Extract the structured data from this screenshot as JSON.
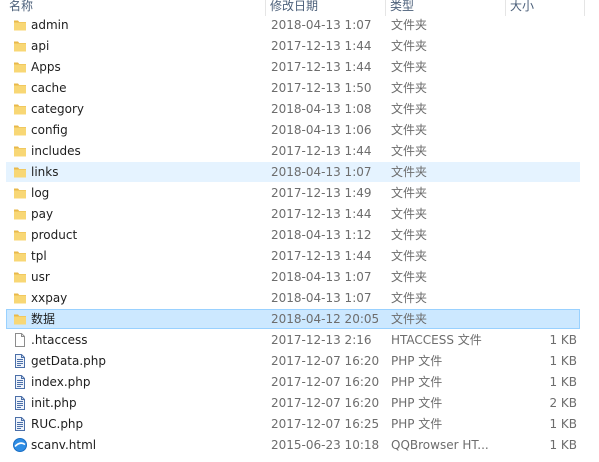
{
  "columns": {
    "name": "名称",
    "date": "修改日期",
    "type": "类型",
    "size": "大小"
  },
  "files": [
    {
      "name": "admin",
      "date": "2018-04-13 1:07",
      "type": "文件夹",
      "size": "",
      "icon": "folder-icon",
      "state": "normal"
    },
    {
      "name": "api",
      "date": "2017-12-13 1:44",
      "type": "文件夹",
      "size": "",
      "icon": "folder-icon",
      "state": "normal"
    },
    {
      "name": "Apps",
      "date": "2017-12-13 1:44",
      "type": "文件夹",
      "size": "",
      "icon": "folder-icon",
      "state": "normal"
    },
    {
      "name": "cache",
      "date": "2017-12-13 1:50",
      "type": "文件夹",
      "size": "",
      "icon": "folder-icon",
      "state": "normal"
    },
    {
      "name": "category",
      "date": "2018-04-13 1:08",
      "type": "文件夹",
      "size": "",
      "icon": "folder-icon",
      "state": "normal"
    },
    {
      "name": "config",
      "date": "2018-04-13 1:06",
      "type": "文件夹",
      "size": "",
      "icon": "folder-icon",
      "state": "normal"
    },
    {
      "name": "includes",
      "date": "2017-12-13 1:44",
      "type": "文件夹",
      "size": "",
      "icon": "folder-icon",
      "state": "normal"
    },
    {
      "name": "links",
      "date": "2018-04-13 1:07",
      "type": "文件夹",
      "size": "",
      "icon": "folder-icon",
      "state": "hover"
    },
    {
      "name": "log",
      "date": "2017-12-13 1:49",
      "type": "文件夹",
      "size": "",
      "icon": "folder-icon",
      "state": "normal"
    },
    {
      "name": "pay",
      "date": "2017-12-13 1:44",
      "type": "文件夹",
      "size": "",
      "icon": "folder-icon",
      "state": "normal"
    },
    {
      "name": "product",
      "date": "2018-04-13 1:12",
      "type": "文件夹",
      "size": "",
      "icon": "folder-icon",
      "state": "normal"
    },
    {
      "name": "tpl",
      "date": "2017-12-13 1:44",
      "type": "文件夹",
      "size": "",
      "icon": "folder-icon",
      "state": "normal"
    },
    {
      "name": "usr",
      "date": "2018-04-13 1:07",
      "type": "文件夹",
      "size": "",
      "icon": "folder-icon",
      "state": "normal"
    },
    {
      "name": "xxpay",
      "date": "2018-04-13 1:07",
      "type": "文件夹",
      "size": "",
      "icon": "folder-icon",
      "state": "normal"
    },
    {
      "name": "数据",
      "date": "2018-04-12 20:05",
      "type": "文件夹",
      "size": "",
      "icon": "folder-icon",
      "state": "selected"
    },
    {
      "name": ".htaccess",
      "date": "2017-12-13 2:16",
      "type": "HTACCESS 文件",
      "size": "1 KB",
      "icon": "file-icon",
      "state": "normal"
    },
    {
      "name": "getData.php",
      "date": "2017-12-07 16:20",
      "type": "PHP 文件",
      "size": "1 KB",
      "icon": "php-file-icon",
      "state": "normal"
    },
    {
      "name": "index.php",
      "date": "2017-12-07 16:20",
      "type": "PHP 文件",
      "size": "1 KB",
      "icon": "php-file-icon",
      "state": "normal"
    },
    {
      "name": "init.php",
      "date": "2017-12-07 16:20",
      "type": "PHP 文件",
      "size": "2 KB",
      "icon": "php-file-icon",
      "state": "normal"
    },
    {
      "name": "RUC.php",
      "date": "2017-12-07 16:25",
      "type": "PHP 文件",
      "size": "1 KB",
      "icon": "php-file-icon",
      "state": "normal"
    },
    {
      "name": "scanv.html",
      "date": "2015-06-23 10:18",
      "type": "QQBrowser HT...",
      "size": "1 KB",
      "icon": "browser-html-icon",
      "state": "normal"
    }
  ],
  "colors": {
    "folder": "#f8d775",
    "hover_bg": "#e5f3ff",
    "selected_bg": "#cce8ff",
    "selected_border": "#99d1ff",
    "header_text": "#4c607a",
    "meta_text": "#6d6d6d"
  }
}
